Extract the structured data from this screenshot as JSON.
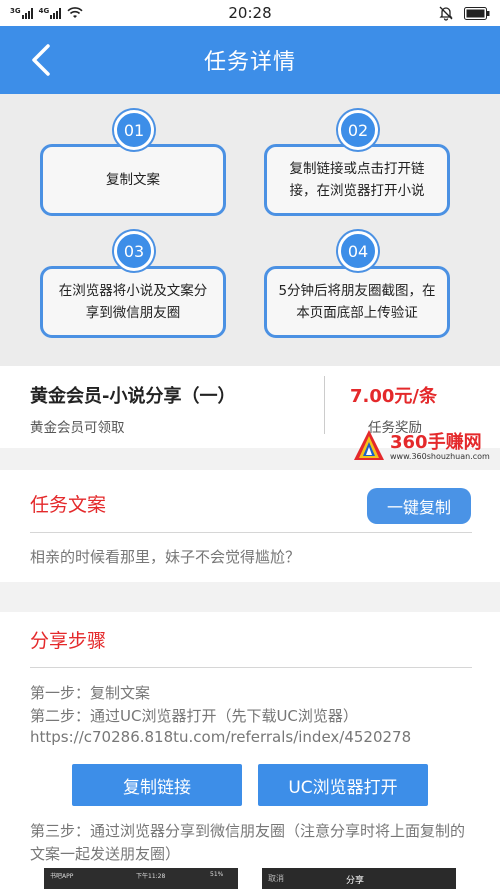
{
  "status_bar": {
    "network_1": "3G",
    "network_2": "4G",
    "time": "20:28"
  },
  "header": {
    "title": "任务详情"
  },
  "steps": [
    {
      "num": "01",
      "text": "复制文案"
    },
    {
      "num": "02",
      "text": "复制链接或点击打开链接，在浏览器打开小说"
    },
    {
      "num": "03",
      "text": "在浏览器将小说及文案分享到微信朋友圈"
    },
    {
      "num": "04",
      "text": "5分钟后将朋友圈截图，在本页面底部上传验证"
    }
  ],
  "task": {
    "title": "黄金会员-小说分享（一）",
    "subtitle": "黄金会员可领取",
    "price": "7.00元/条",
    "reward_label": "任务奖励"
  },
  "watermark": {
    "text": "360手赚网",
    "url": "www.360shouzhuan.com"
  },
  "copy_section": {
    "title": "任务文案",
    "button": "一键复制",
    "text": "相亲的时候看那里，妹子不会觉得尴尬？"
  },
  "share_section": {
    "title": "分享步骤",
    "step1": "第一步：复制文案",
    "step2": "第二步：通过UC浏览器打开（先下载UC浏览器）",
    "url": "https://c70286.818tu.com/referrals/index/4520278",
    "copy_link_button": "复制链接",
    "uc_open_button": "UC浏览器打开",
    "step3": "第三步：通过浏览器分享到微信朋友圈（注意分享时将上面复制的文案一起发送朋友圈）"
  },
  "thumbnails": {
    "left_app": "书吧APP",
    "left_time": "下午11:28",
    "left_battery": "51%",
    "right_cancel": "取消",
    "right_share": "分享"
  },
  "colors": {
    "primary": "#3d8ee8",
    "accent_red": "#e4292b"
  }
}
